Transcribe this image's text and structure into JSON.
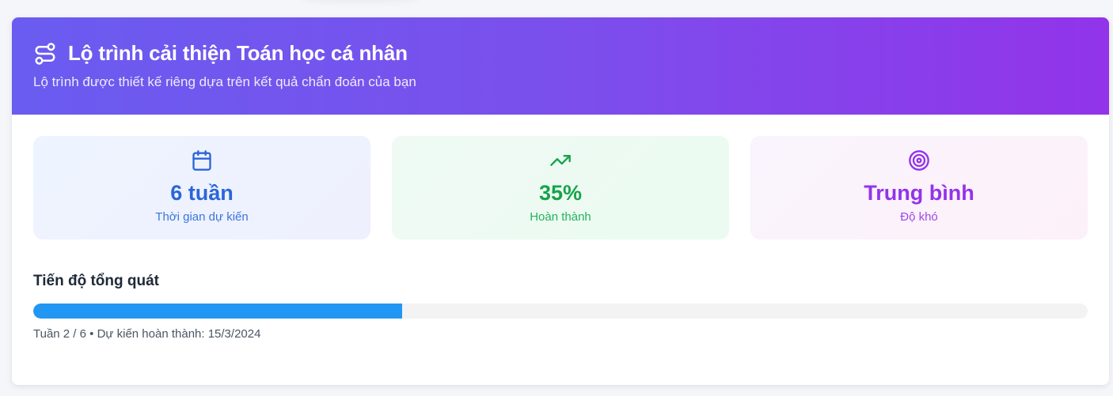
{
  "header": {
    "title": "Lộ trình cải thiện Toán học cá nhân",
    "subtitle": "Lộ trình được thiết kế riêng dựa trên kết quả chẩn đoán của bạn",
    "icon": "route-icon"
  },
  "stats": [
    {
      "icon": "calendar-icon",
      "value": "6 tuần",
      "label": "Thời gian dự kiến",
      "color": "#2a66d9"
    },
    {
      "icon": "trending-up-icon",
      "value": "35%",
      "label": "Hoàn thành",
      "color": "#16a34a"
    },
    {
      "icon": "target-icon",
      "value": "Trung bình",
      "label": "Độ khó",
      "color": "#9333ea"
    }
  ],
  "progress": {
    "title": "Tiến độ tổng quát",
    "percent": 35,
    "caption": "Tuần 2 / 6 • Dự kiến hoàn thành: 15/3/2024",
    "color": "#2196f3"
  },
  "colors": {
    "header_gradient_start": "#6a5cf0",
    "header_gradient_end": "#9234ea"
  }
}
